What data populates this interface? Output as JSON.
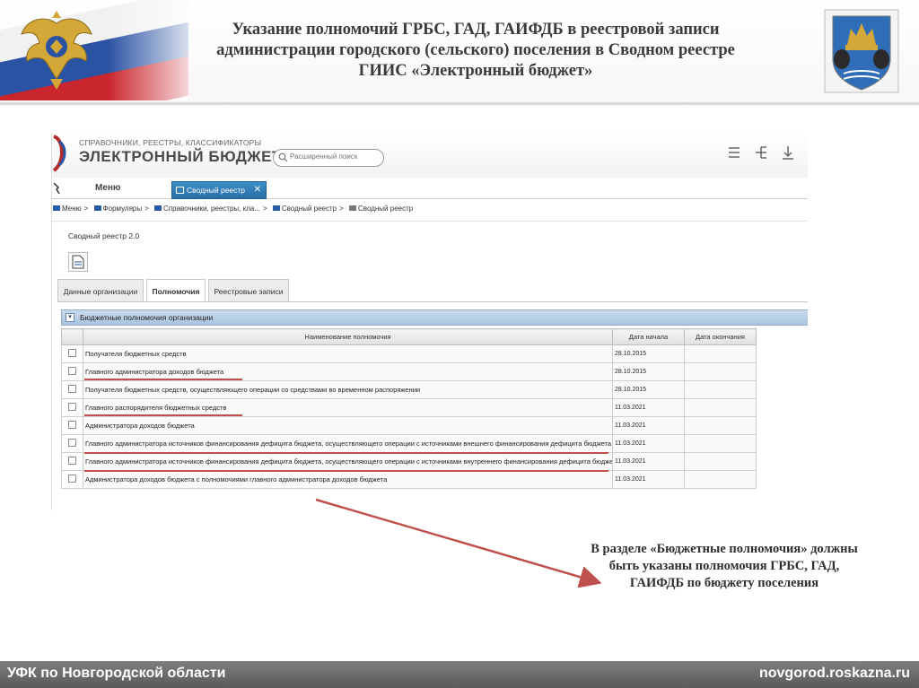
{
  "slide": {
    "title_lines": [
      "Указание полномочий ГРБС, ГАД, ГАИФДБ в реестровой записи",
      "администрации городского (сельского) поселения в Сводном реестре",
      "ГИИС «Электронный бюджет»"
    ],
    "annotation_lines": [
      "В разделе «Бюджетные полномочия» должны",
      "быть указаны полномочия ГРБС, ГАД,",
      "ГАИФДБ по бюджету поселения"
    ],
    "footer_left": "УФК по Новгородской области",
    "footer_right": "novgorod.roskazna.ru",
    "accent_color": "#c0504d"
  },
  "app": {
    "subtitle": "СПРАВОЧНИКИ, РЕЕСТРЫ, КЛАССИФИКАТОРЫ",
    "title": "ЭЛЕКТРОННЫЙ БЮДЖЕТ",
    "search_placeholder": "Расширенный поиск",
    "menu_label": "Меню",
    "active_tab": "Сводный реестр",
    "breadcrumb": [
      "Меню",
      "Формуляры",
      "Справочники, реестры, кла...",
      "Сводный реестр",
      "Сводный реестр"
    ],
    "page_title": "Сводный реестр 2.0",
    "tabs": [
      "Данные организации",
      "Полномочия",
      "Реестровые записи"
    ],
    "selected_tab": "Полномочия",
    "section_title": "Бюджетные полномочия организации",
    "columns": [
      "Наименование полномочия",
      "Дата начала",
      "Дата окончания"
    ],
    "rows": [
      {
        "name": "Получателя бюджетных средств",
        "start": "28.10.2015",
        "end": ""
      },
      {
        "name": "Главного администратора доходов бюджета",
        "start": "28.10.2015",
        "end": ""
      },
      {
        "name": "Получателя бюджетных средств, осуществляющего операции со средствами во временном распоряжении",
        "start": "28.10.2015",
        "end": ""
      },
      {
        "name": "Главного распорядителя бюджетных средств",
        "start": "11.03.2021",
        "end": ""
      },
      {
        "name": "Администратора доходов бюджета",
        "start": "11.03.2021",
        "end": ""
      },
      {
        "name": "Главного администратора источников финансирования дефицита бюджета, осуществляющего операции с источниками внешнего финансирования дефицита бюджета",
        "start": "11.03.2021",
        "end": ""
      },
      {
        "name": "Главного администратора источников финансирования дефицита бюджета, осуществляющего операции с источниками внутреннего финансирования дефицита бюджета",
        "start": "11.03.2021",
        "end": ""
      },
      {
        "name": "Администратора доходов бюджета с полномочиями главного администратора доходов бюджета",
        "start": "11.03.2021",
        "end": ""
      }
    ]
  }
}
